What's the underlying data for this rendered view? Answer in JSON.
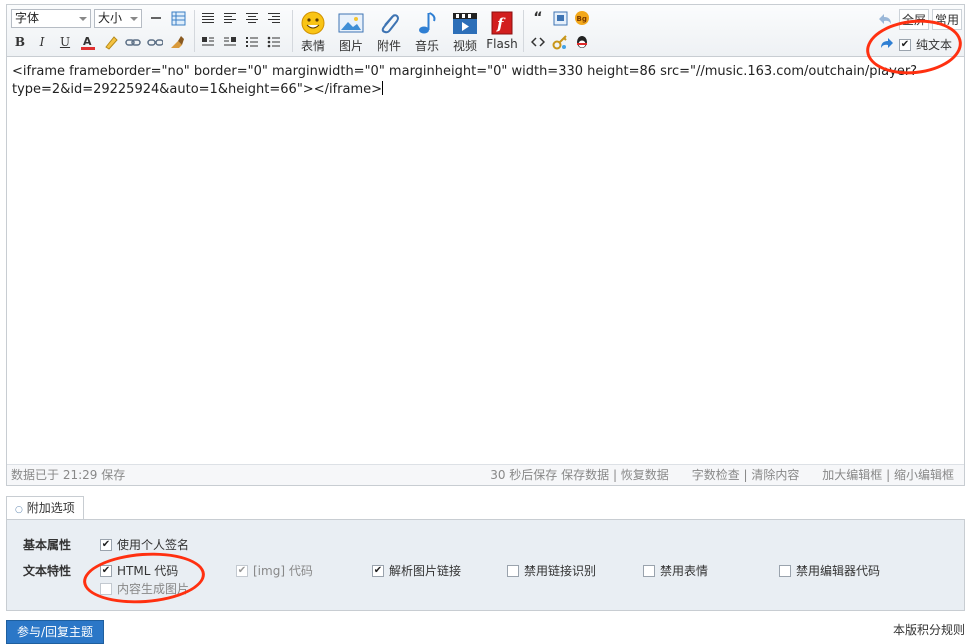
{
  "toolbar": {
    "font_select": "字体",
    "size_select": "大小",
    "buttons_big": [
      {
        "label": "表情",
        "icon": "smiley-icon"
      },
      {
        "label": "图片",
        "icon": "image-icon"
      },
      {
        "label": "附件",
        "icon": "paperclip-icon"
      },
      {
        "label": "音乐",
        "icon": "music-note-icon"
      },
      {
        "label": "视频",
        "icon": "video-clapper-icon"
      },
      {
        "label": "Flash",
        "icon": "flash-icon"
      }
    ],
    "fullscreen": "全屏",
    "common": "常用",
    "plain_text": "纯文本"
  },
  "editor": {
    "content_line1": "<iframe frameborder=\"no\" border=\"0\" marginwidth=\"0\" marginheight=\"0\" width=330 height=86 src=\"//music.163.com/outchain/player?",
    "content_line2": "type=2&id=29225924&auto=1&height=66\"></iframe>"
  },
  "statusbar": {
    "saved_at": "数据已于 21:29 保存",
    "autosave": "30 秒后保存",
    "save_data": "保存数据",
    "restore_data": "恢复数据",
    "word_check": "字数检查",
    "clear_content": "清除内容",
    "enlarge": "加大编辑框",
    "shrink": "缩小编辑框"
  },
  "options": {
    "tab_label": "附加选项",
    "basic_label": "基本属性",
    "text_label": "文本特性",
    "use_signature": "使用个人签名",
    "html_code": "HTML 代码",
    "content_image": "内容生成图片",
    "img_code": "[img] 代码",
    "parse_image_link": "解析图片链接",
    "disable_link_detect": "禁用链接识别",
    "disable_smilies": "禁用表情",
    "disable_editor_code": "禁用编辑器代码"
  },
  "footer": {
    "submit": "参与/回复主题",
    "rules": "本版积分规则"
  },
  "colors": {
    "accent": "#2b77c7",
    "annotation": "#ff3010"
  }
}
